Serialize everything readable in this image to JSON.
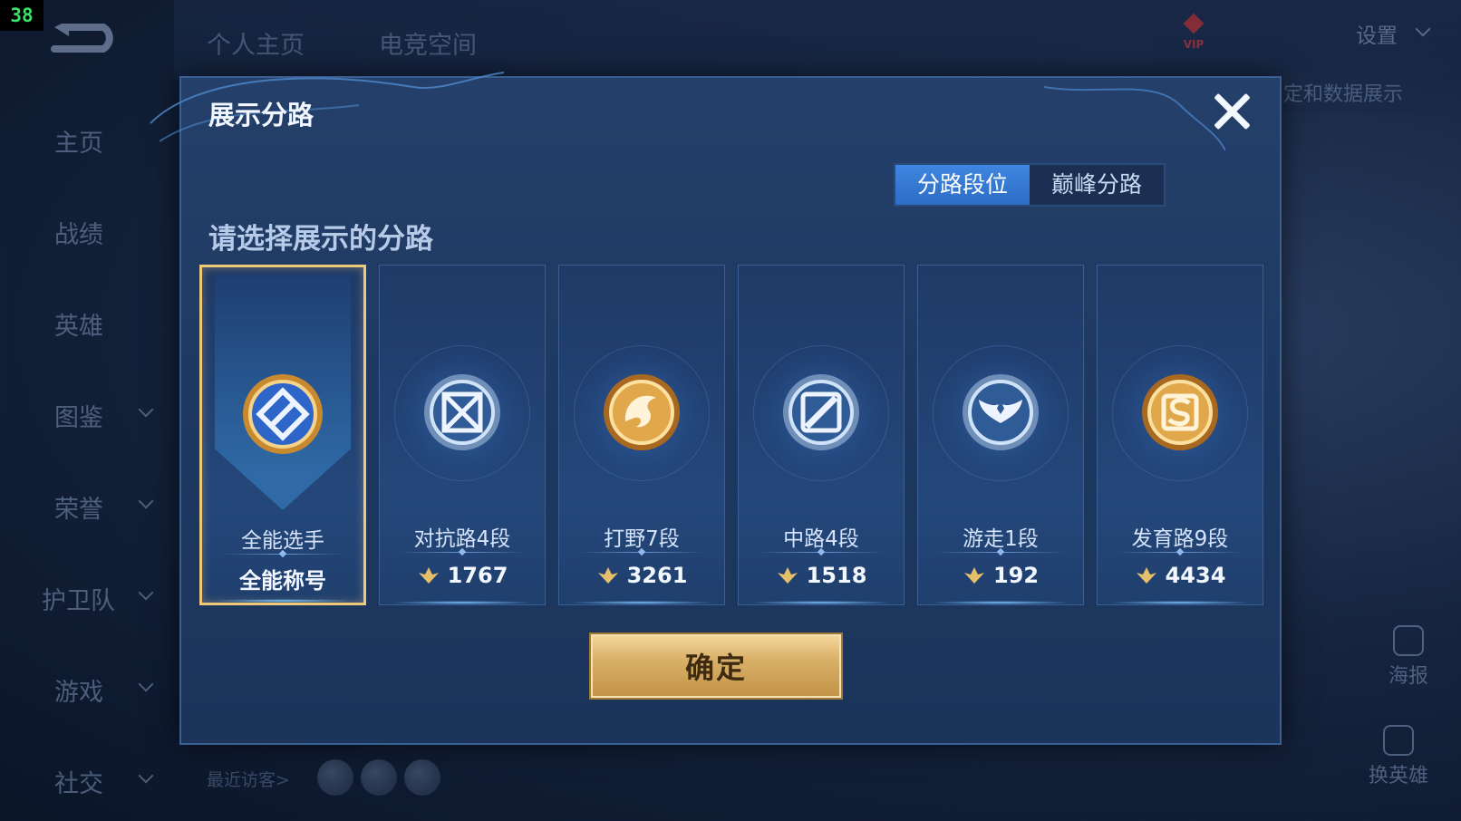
{
  "fps": "38",
  "background": {
    "top_tabs": [
      "个人主页",
      "电竞空间"
    ],
    "settings_label": "设置",
    "vip_label": "VIP",
    "data_show_label": "定和数据展示",
    "sidebar": [
      {
        "label": "主页",
        "has_chevron": false
      },
      {
        "label": "战绩",
        "has_chevron": false
      },
      {
        "label": "英雄",
        "has_chevron": false
      },
      {
        "label": "图鉴",
        "has_chevron": true
      },
      {
        "label": "荣誉",
        "has_chevron": true
      },
      {
        "label": "护卫队",
        "has_chevron": true
      },
      {
        "label": "游戏",
        "has_chevron": true
      },
      {
        "label": "社交",
        "has_chevron": true
      }
    ],
    "recent_visitors_label": "最近访客>",
    "right_buttons": [
      "海报",
      "换英雄"
    ]
  },
  "modal": {
    "title": "展示分路",
    "tabs": [
      {
        "label": "分路段位",
        "active": true
      },
      {
        "label": "巅峰分路",
        "active": false
      }
    ],
    "subtitle": "请选择展示的分路",
    "cards": [
      {
        "role": "全能选手",
        "label": "全能称号",
        "score": null,
        "selected": true,
        "emblem": "all-round-emblem",
        "color": "#f0c87a"
      },
      {
        "role": "对抗路4段",
        "score": "1767",
        "selected": false,
        "emblem": "clash-lane-emblem",
        "color": "#a9c6e6"
      },
      {
        "role": "打野7段",
        "score": "3261",
        "selected": false,
        "emblem": "jungle-emblem",
        "color": "#e3a640"
      },
      {
        "role": "中路4段",
        "score": "1518",
        "selected": false,
        "emblem": "mid-lane-emblem",
        "color": "#a9c6e6"
      },
      {
        "role": "游走1段",
        "score": "192",
        "selected": false,
        "emblem": "roam-emblem",
        "color": "#a9c6e6"
      },
      {
        "role": "发育路9段",
        "score": "4434",
        "selected": false,
        "emblem": "farm-lane-emblem",
        "color": "#e3a640"
      }
    ],
    "confirm_label": "确定"
  }
}
